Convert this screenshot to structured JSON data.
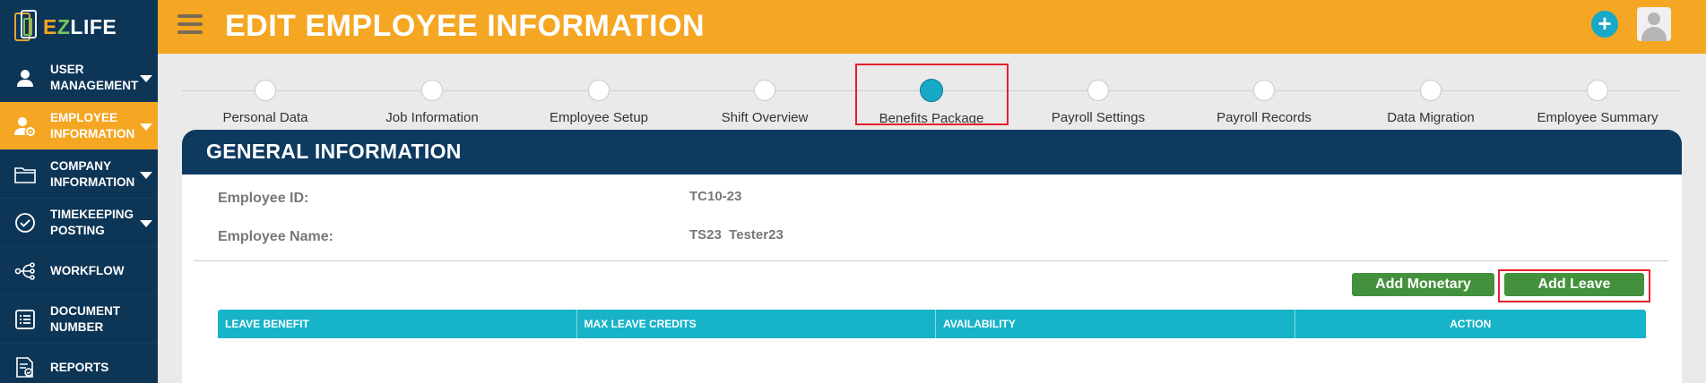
{
  "app": {
    "logo_e": "E",
    "logo_z": "Z",
    "logo_life": "LIFE"
  },
  "header": {
    "title": "EDIT EMPLOYEE INFORMATION",
    "add_symbol": "+"
  },
  "sidebar": {
    "items": [
      {
        "label": "USER MANAGEMENT",
        "icon": "user-icon",
        "has_caret": true,
        "active": false
      },
      {
        "label": "EMPLOYEE INFORMATION",
        "icon": "employee-settings-icon",
        "has_caret": true,
        "active": true
      },
      {
        "label": "COMPANY INFORMATION",
        "icon": "folder-icon",
        "has_caret": true,
        "active": false
      },
      {
        "label": "TIMEKEEPING POSTING",
        "icon": "check-circle-icon",
        "has_caret": true,
        "active": false
      },
      {
        "label": "WORKFLOW",
        "icon": "workflow-icon",
        "has_caret": false,
        "active": false
      },
      {
        "label": "DOCUMENT NUMBER",
        "icon": "list-icon",
        "has_caret": false,
        "active": false
      },
      {
        "label": "REPORTS",
        "icon": "report-icon",
        "has_caret": false,
        "active": false
      }
    ]
  },
  "stepper": {
    "steps": [
      "Personal Data",
      "Job Information",
      "Employee Setup",
      "Shift Overview",
      "Benefits Package",
      "Payroll Settings",
      "Payroll Records",
      "Data Migration",
      "Employee Summary"
    ],
    "current": "Benefits Package"
  },
  "general_info": {
    "title": "GENERAL INFORMATION",
    "employee_id_label": "Employee ID:",
    "employee_id_value": "TC10-23",
    "employee_name_label": "Employee Name:",
    "employee_name_value": "TS23  Tester23"
  },
  "actions": {
    "add_monetary": "Add Monetary",
    "add_leave": "Add Leave"
  },
  "leave_table": {
    "columns": [
      "LEAVE BENEFIT",
      "MAX LEAVE CREDITS",
      "AVAILABILITY",
      "ACTION"
    ]
  },
  "colors": {
    "accent": "#f5a623",
    "sidebar": "#0d3556",
    "header_card": "#0e3a60",
    "table_header": "#17b3c8",
    "button_green": "#43913c",
    "highlight": "#e51f2b"
  }
}
